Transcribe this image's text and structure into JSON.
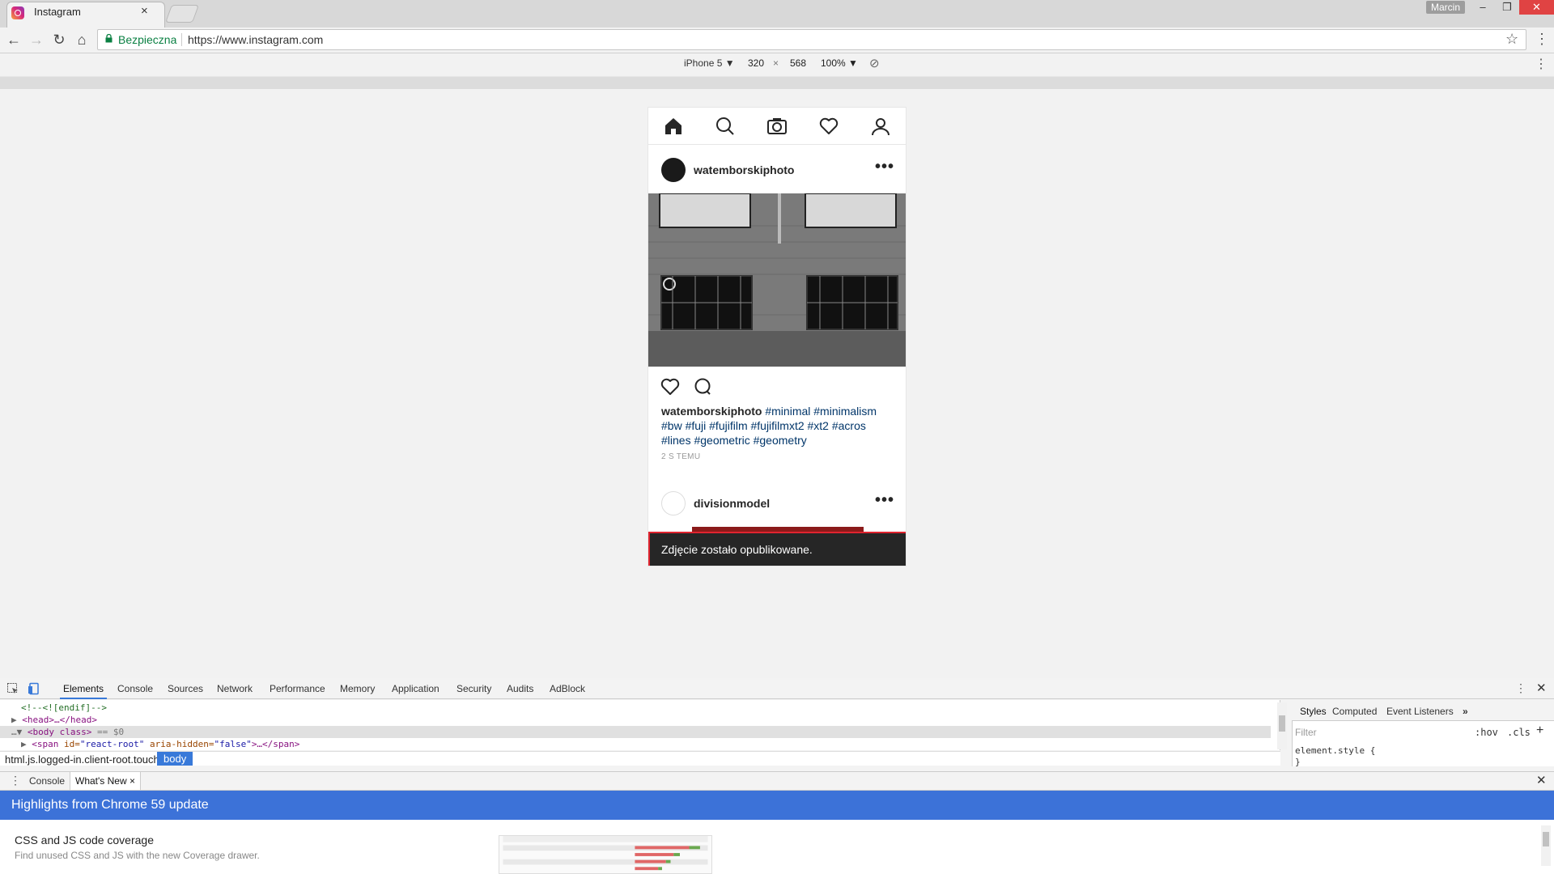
{
  "browser": {
    "tab_title": "Instagram",
    "tab_close": "×",
    "user_chip": "Marcin",
    "security_label": "Bezpieczna",
    "url": "https://www.instagram.com",
    "star": "☆",
    "menu": "⋮"
  },
  "device_toolbar": {
    "device": "iPhone 5 ▼",
    "width": "320",
    "times": "×",
    "height": "568",
    "zoom": "100% ▼"
  },
  "instagram": {
    "nav_icons": [
      "home-icon",
      "search-icon",
      "camera-icon",
      "heart-icon",
      "profile-icon"
    ],
    "post1": {
      "username": "watemborskiphoto",
      "more": "•••",
      "caption_user": "watemborskiphoto",
      "caption_tags": "#minimal #minimalism #bw #fuji #fujifilm #fujifilmxt2 #xt2 #acros #lines #geometric #geometry",
      "timestamp": "2 S TEMU"
    },
    "post2": {
      "username": "divisionmodel",
      "more": "•••"
    },
    "snackbar": "Zdjęcie zostało opublikowane."
  },
  "devtools": {
    "tabs": [
      "Elements",
      "Console",
      "Sources",
      "Network",
      "Performance",
      "Memory",
      "Application",
      "Security",
      "Audits",
      "AdBlock"
    ],
    "dom": {
      "line1": "<!--<![endif]-->",
      "line2_tag": "<head>…</head>",
      "line3_open": "<body class>",
      "line3_suffix": " == $0",
      "line4_tag_open": "<span",
      "line4_attr1": " id=",
      "line4_val1": "\"react-root\"",
      "line4_attr2": " aria-hidden=",
      "line4_val2": "\"false\"",
      "line4_tag_close": ">…</span>"
    },
    "breadcrumb": {
      "html": "html.js.logged-in.client-root.touch",
      "body": "body"
    },
    "styles": {
      "tabs": [
        "Styles",
        "Computed",
        "Event Listeners",
        "»"
      ],
      "filter_placeholder": "Filter",
      "hov": ":hov",
      "cls": ".cls",
      "plus": "+",
      "rule": "element.style {",
      "rule_end": "}"
    },
    "drawer": {
      "console": "Console",
      "whats_new": "What's New",
      "whats_new_close": "×",
      "banner": "Highlights from Chrome 59 update",
      "item_title": "CSS and JS code coverage",
      "item_desc": "Find unused CSS and JS with the new Coverage drawer."
    }
  }
}
